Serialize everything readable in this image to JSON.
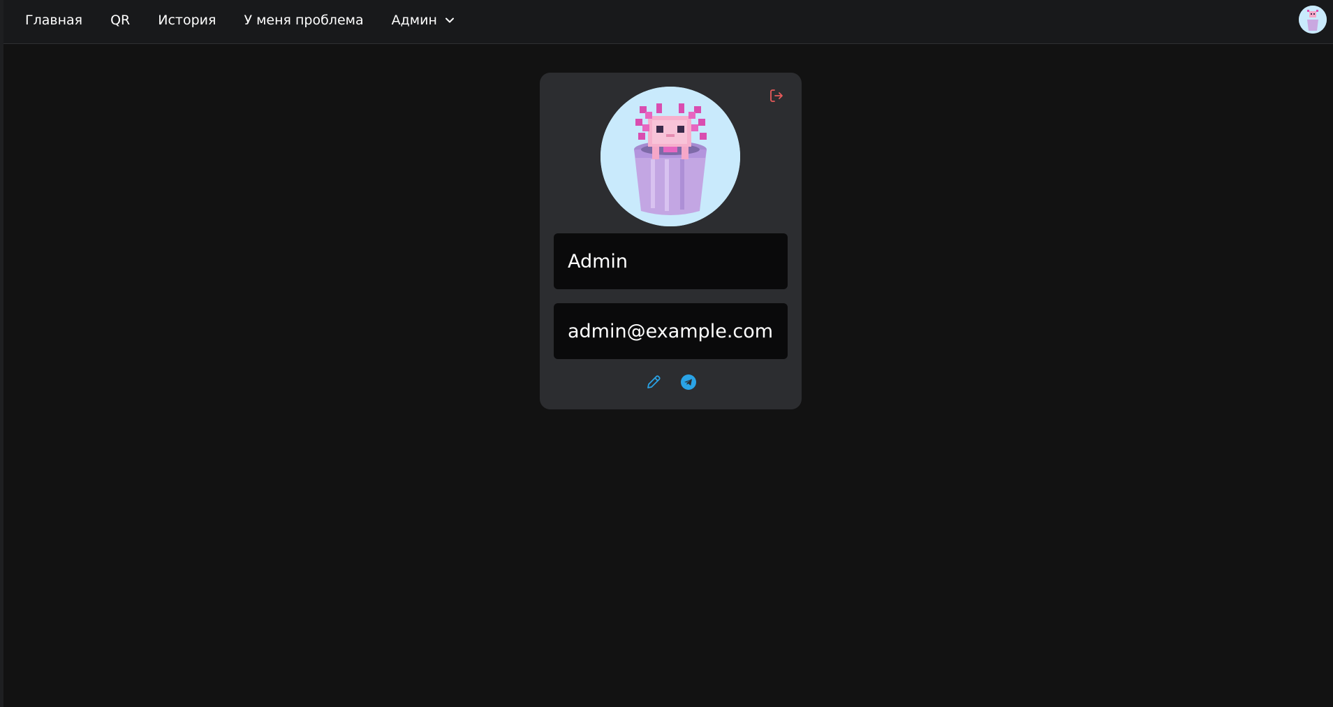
{
  "nav": {
    "items": [
      "Главная",
      "QR",
      "История",
      "У меня проблема",
      "Админ"
    ],
    "admin_menu_icon": "chevron-down-icon",
    "user_avatar_icon": "axolotl-bucket-avatar"
  },
  "profile": {
    "name": "Admin",
    "email": "admin@example.com",
    "logout_icon": "logout-icon",
    "edit_icon": "pencil-icon",
    "telegram_icon": "telegram-icon"
  },
  "colors": {
    "background": "#121212",
    "navbar": "#18191b",
    "card": "#2c2d30",
    "input": "#0a0a0b",
    "logout": "#e85a5a",
    "accent": "#2aa3e6",
    "avatar_bg": "#c9eafc"
  }
}
